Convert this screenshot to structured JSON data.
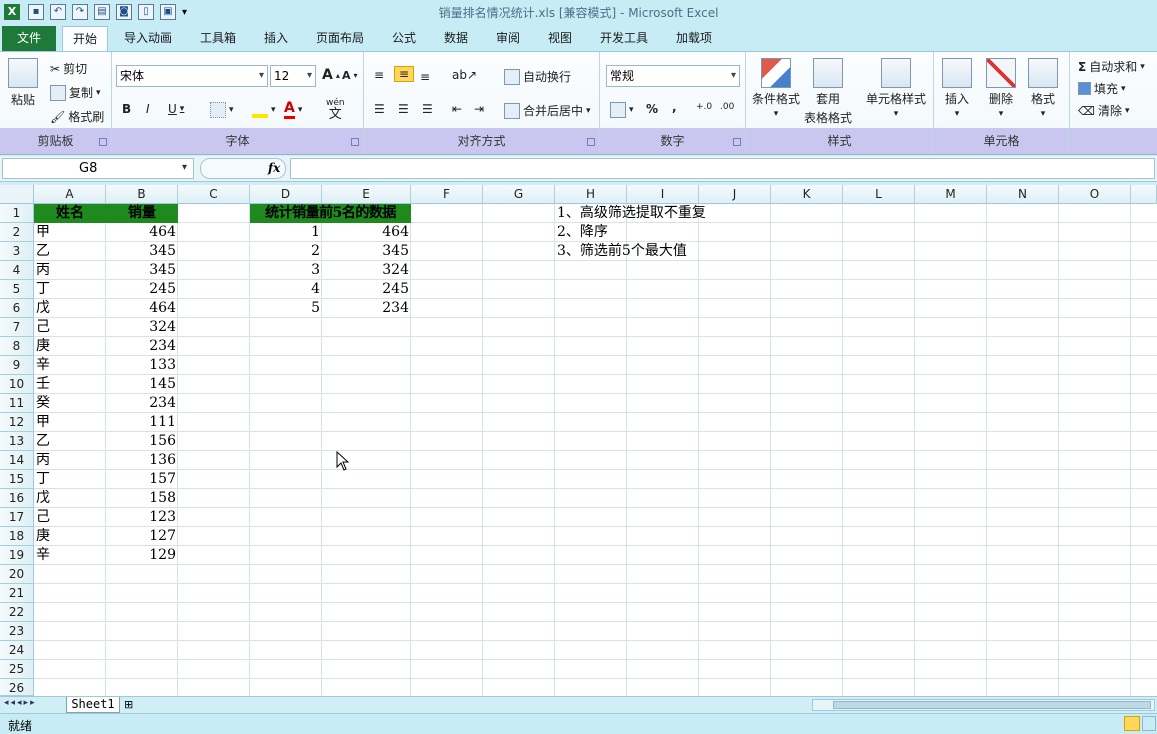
{
  "window": {
    "title": "销量排名情况统计.xls  [兼容模式]  -  Microsoft Excel",
    "app_icon": "X"
  },
  "tabs": [
    "文件",
    "开始",
    "导入动画",
    "工具箱",
    "插入",
    "页面布局",
    "公式",
    "数据",
    "审阅",
    "视图",
    "开发工具",
    "加载项"
  ],
  "ribbon": {
    "clipboard": {
      "paste": "粘贴",
      "cut": "剪切",
      "copy": "复制",
      "format_painter": "格式刷",
      "label": "剪贴板"
    },
    "font": {
      "name": "宋体",
      "size": "12",
      "bold": "B",
      "italic": "I",
      "underline": "U",
      "wen": "wén",
      "wen_char": "文",
      "grow": "A",
      "shrink": "A",
      "color_letter": "A",
      "label": "字体"
    },
    "alignment": {
      "wrap": "自动换行",
      "merge": "合并后居中",
      "label": "对齐方式"
    },
    "number": {
      "format": "常规",
      "percent": "%",
      "comma": ",",
      "inc": "+.0",
      "dec": ".00",
      "label": "数字"
    },
    "styles": {
      "conditional": "条件格式",
      "table_1": "套用",
      "table_2": "表格格式",
      "cell_styles": "单元格样式",
      "label": "样式"
    },
    "cells": {
      "insert": "插入",
      "delete": "删除",
      "format": "格式",
      "label": "单元格"
    },
    "editing": {
      "autosum": "自动求和",
      "sigma": "Σ",
      "fill": "填充",
      "clear": "清除"
    }
  },
  "formula_bar": {
    "name_box": "G8",
    "fx": "fx",
    "formula": ""
  },
  "columns": [
    "A",
    "B",
    "C",
    "D",
    "E",
    "F",
    "G",
    "H",
    "I",
    "J",
    "K",
    "L",
    "M",
    "N",
    "O"
  ],
  "rows": [
    "1",
    "2",
    "3",
    "4",
    "5",
    "6",
    "7",
    "8",
    "9",
    "10",
    "11",
    "12",
    "13",
    "14",
    "15",
    "16",
    "17",
    "18",
    "19",
    "20",
    "21",
    "22",
    "23",
    "24",
    "25",
    "26"
  ],
  "sheet": {
    "a1": "姓名",
    "b1": "销量",
    "d1": "统计销量前5名的数据",
    "names": [
      "甲",
      "乙",
      "丙",
      "丁",
      "戊",
      "己",
      "庚",
      "辛",
      "壬",
      "癸",
      "甲",
      "乙",
      "丙",
      "丁",
      "戊",
      "己",
      "庚",
      "辛"
    ],
    "sales": [
      "464",
      "345",
      "345",
      "245",
      "464",
      "324",
      "234",
      "133",
      "145",
      "234",
      "111",
      "156",
      "136",
      "157",
      "158",
      "123",
      "127",
      "129"
    ],
    "rank": [
      "1",
      "2",
      "3",
      "4",
      "5"
    ],
    "top": [
      "464",
      "345",
      "324",
      "245",
      "234"
    ],
    "notes": [
      "1、高级筛选提取不重复",
      "2、降序",
      "3、筛选前5个最大值"
    ]
  },
  "sheet_tab": "Sheet1",
  "status": "就绪"
}
